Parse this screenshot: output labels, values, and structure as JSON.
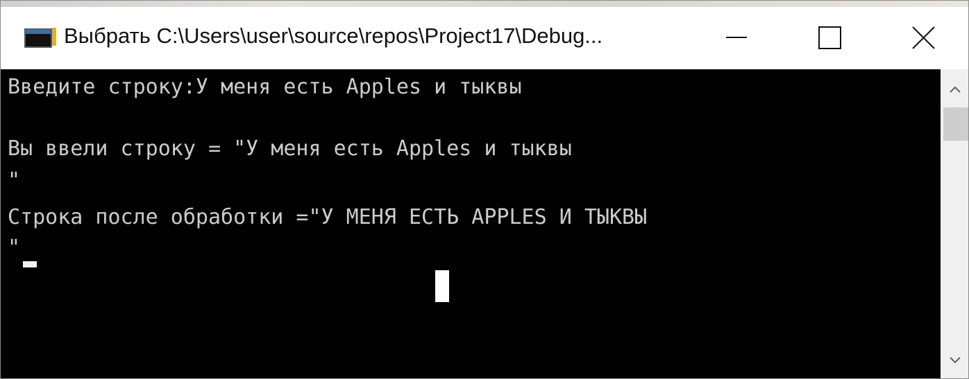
{
  "window": {
    "title": "Выбрать C:\\Users\\user\\source\\repos\\Project17\\Debug..."
  },
  "console": {
    "lines": [
      "Введите строку:У меня есть Apples и тыквы",
      "",
      "Вы ввели строку = \"У меня есть Apples и тыквы",
      "\"",
      "Строка после обработки =\"У МЕНЯ ЕСТЬ APPLES И ТЫКВЫ",
      "\""
    ]
  },
  "icons": {
    "app": "console-app-icon",
    "minimize": "minimize-icon",
    "maximize": "maximize-icon",
    "close": "close-icon",
    "scroll_up": "chevron-up-icon",
    "scroll_down": "chevron-down-icon"
  },
  "colors": {
    "console_bg": "#000000",
    "console_text": "#cccccc",
    "titlebar_bg": "#ffffff",
    "scrollbar_bg": "#f0f0f0"
  }
}
